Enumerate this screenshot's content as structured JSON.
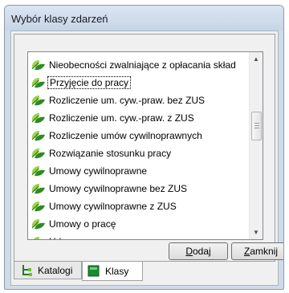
{
  "window": {
    "title": "Wybór klasy zdarzeń"
  },
  "list": {
    "selected_index": 1,
    "items": [
      {
        "label": "Nieobecności zwalniające z opłacania skład"
      },
      {
        "label": "Przyjęcie do pracy"
      },
      {
        "label": "Rozliczenie um. cyw.-praw. bez ZUS"
      },
      {
        "label": "Rozliczenie um. cyw.-praw. z ZUS"
      },
      {
        "label": "Rozliczenie umów cywilnoprawnych"
      },
      {
        "label": "Rozwiązanie stosunku pracy"
      },
      {
        "label": "Umowy cywilnoprawne"
      },
      {
        "label": "Umowy cywilnoprawne bez ZUS"
      },
      {
        "label": "Umowy cywilnoprawne z ZUS"
      },
      {
        "label": "Umowy o pracę"
      },
      {
        "label": "Urlopy"
      }
    ],
    "item_icon": "green-leaf-icon"
  },
  "buttons": {
    "add": {
      "underline": "D",
      "rest": "odaj"
    },
    "close": {
      "underline": "Z",
      "rest": "amknij"
    }
  },
  "tabs": {
    "catalogs": {
      "label": "Katalogi",
      "icon": "tree-icon"
    },
    "classes": {
      "label": "Klasy",
      "icon": "green-square-icon",
      "active": true
    }
  },
  "colors": {
    "leaf_light": "#9bd44a",
    "leaf_dark": "#2e8a25",
    "class_icon": "#1a8a2f"
  }
}
